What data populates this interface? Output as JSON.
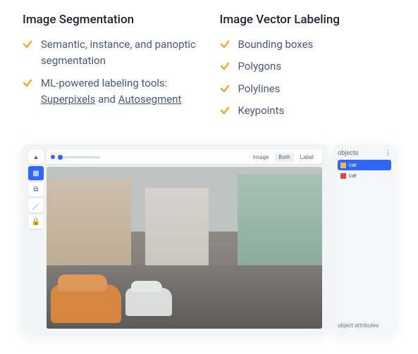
{
  "left": {
    "title": "Image Segmentation",
    "items": [
      {
        "prefix": "Semantic, instance, and panoptic segmentation"
      },
      {
        "prefix": "ML-powered labeling tools: ",
        "link1": "Superpixels",
        "mid": " and ",
        "link2": "Autosegment"
      }
    ]
  },
  "right": {
    "title": "Image Vector Labeling",
    "items": [
      "Bounding boxes",
      "Polygons",
      "Polylines",
      "Keypoints"
    ]
  },
  "editor": {
    "modes": {
      "a": "Image",
      "b": "Both",
      "c": "Label"
    }
  },
  "sidepane": {
    "title": "objects",
    "rows": [
      {
        "label": "car",
        "color": "#f3b54a",
        "selected": true
      },
      {
        "label": "car",
        "color": "#d94b3f",
        "selected": false
      }
    ],
    "footer": "object attributes"
  }
}
